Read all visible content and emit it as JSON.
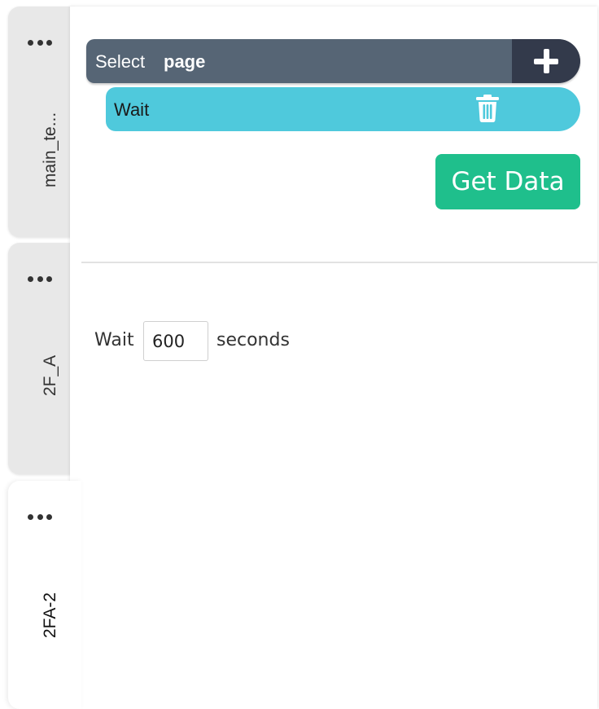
{
  "tabs": [
    {
      "label": "main_te..."
    },
    {
      "label": "2F_A"
    },
    {
      "label": "2FA-2"
    }
  ],
  "select_bar": {
    "label": "Select",
    "value": "page"
  },
  "step": {
    "label": "Wait"
  },
  "get_data_label": "Get Data",
  "wait_setting": {
    "label": "Wait",
    "value": "600",
    "unit": "seconds"
  },
  "colors": {
    "select_bar": "#566575",
    "add_button": "#333a4b",
    "step": "#4fc9dc",
    "get_data": "#1fbf8c"
  },
  "icons": {
    "add": "plus-icon",
    "delete": "trash-icon",
    "tab_menu": "more-horizontal-icon"
  }
}
